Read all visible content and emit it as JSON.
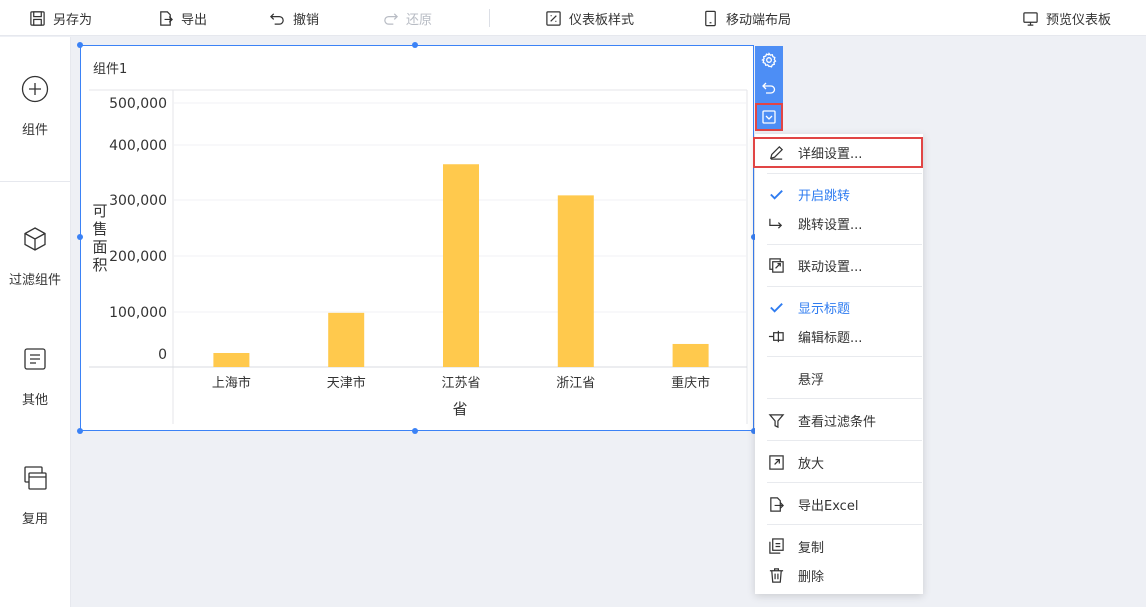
{
  "toolbar": {
    "save_as": "另存为",
    "export": "导出",
    "undo": "撤销",
    "redo": "还原",
    "dashboard_style": "仪表板样式",
    "mobile_layout": "移动端布局",
    "preview": "预览仪表板"
  },
  "sidebar": {
    "items": [
      {
        "label": "组件",
        "icon": "plus-circle-icon"
      },
      {
        "label": "过滤组件",
        "icon": "cube-icon"
      },
      {
        "label": "其他",
        "icon": "document-icon"
      },
      {
        "label": "复用",
        "icon": "copy-icon"
      }
    ]
  },
  "widget": {
    "title": "组件1"
  },
  "chart_data": {
    "type": "bar",
    "categories": [
      "上海市",
      "天津市",
      "江苏省",
      "浙江省",
      "重庆市"
    ],
    "values": [
      2000,
      82000,
      378000,
      316000,
      20000
    ],
    "yticks": [
      "500,000",
      "400,000",
      "300,000",
      "200,000",
      "100,000",
      "0"
    ],
    "ytick_values": [
      500000,
      400000,
      300000,
      200000,
      100000,
      0
    ],
    "xlabel": "省",
    "ylabel": "可售面积",
    "ylim": [
      0,
      500000
    ],
    "bar_color": "#ffc94d"
  },
  "menu": {
    "detail_settings": "详细设置...",
    "enable_jump": "开启跳转",
    "jump_settings": "跳转设置...",
    "linkage_settings": "联动设置...",
    "show_title": "显示标题",
    "edit_title": "编辑标题...",
    "float": "悬浮",
    "view_filter": "查看过滤条件",
    "zoom": "放大",
    "export_excel": "导出Excel",
    "copy": "复制",
    "delete": "删除"
  },
  "colors": {
    "accent": "#3b82f6",
    "checked": "#2f7cf0",
    "highlight_border": "#e14545"
  }
}
